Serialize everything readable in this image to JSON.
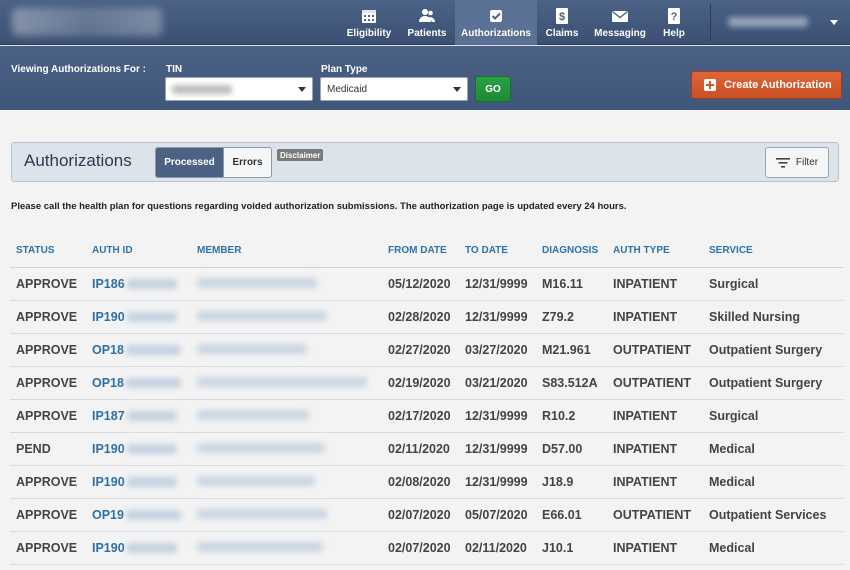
{
  "nav": {
    "items": [
      {
        "label": "Eligibility",
        "icon": "calendar-icon"
      },
      {
        "label": "Patients",
        "icon": "users-icon"
      },
      {
        "label": "Authorizations",
        "icon": "checkbox-icon"
      },
      {
        "label": "Claims",
        "icon": "dollar-doc-icon"
      },
      {
        "label": "Messaging",
        "icon": "envelope-icon"
      },
      {
        "label": "Help",
        "icon": "question-icon"
      }
    ],
    "active": "Authorizations"
  },
  "filters": {
    "viewing_label": "Viewing Authorizations For :",
    "tin_label": "TIN",
    "plan_type_label": "Plan Type",
    "plan_type_value": "Medicaid",
    "go_label": "GO",
    "create_label": "Create Authorization"
  },
  "panel": {
    "title": "Authorizations",
    "tabs": [
      "Processed",
      "Errors"
    ],
    "active_tab": "Processed",
    "disclaimer": "Disclaimer",
    "filter_label": "Filter"
  },
  "notice": "Please call the health plan for questions regarding voided authorization submissions. The authorization page is updated every 24 hours.",
  "table": {
    "columns": [
      "STATUS",
      "AUTH ID",
      "MEMBER",
      "FROM DATE",
      "TO DATE",
      "DIAGNOSIS",
      "AUTH TYPE",
      "SERVICE"
    ],
    "rows": [
      {
        "status": "APPROVE",
        "auth_id": "IP186",
        "from": "05/12/2020",
        "to": "12/31/9999",
        "diagnosis": "M16.11",
        "auth_type": "INPATIENT",
        "service": "Surgical"
      },
      {
        "status": "APPROVE",
        "auth_id": "IP190",
        "from": "02/28/2020",
        "to": "12/31/9999",
        "diagnosis": "Z79.2",
        "auth_type": "INPATIENT",
        "service": "Skilled Nursing"
      },
      {
        "status": "APPROVE",
        "auth_id": "OP18",
        "from": "02/27/2020",
        "to": "03/27/2020",
        "diagnosis": "M21.961",
        "auth_type": "OUTPATIENT",
        "service": "Outpatient Surgery"
      },
      {
        "status": "APPROVE",
        "auth_id": "OP18",
        "from": "02/19/2020",
        "to": "03/21/2020",
        "diagnosis": "S83.512A",
        "auth_type": "OUTPATIENT",
        "service": "Outpatient Surgery"
      },
      {
        "status": "APPROVE",
        "auth_id": "IP187",
        "from": "02/17/2020",
        "to": "12/31/9999",
        "diagnosis": "R10.2",
        "auth_type": "INPATIENT",
        "service": "Surgical"
      },
      {
        "status": "PEND",
        "auth_id": "IP190",
        "from": "02/11/2020",
        "to": "12/31/9999",
        "diagnosis": "D57.00",
        "auth_type": "INPATIENT",
        "service": "Medical"
      },
      {
        "status": "APPROVE",
        "auth_id": "IP190",
        "from": "02/08/2020",
        "to": "12/31/9999",
        "diagnosis": "J18.9",
        "auth_type": "INPATIENT",
        "service": "Medical"
      },
      {
        "status": "APPROVE",
        "auth_id": "OP19",
        "from": "02/07/2020",
        "to": "05/07/2020",
        "diagnosis": "E66.01",
        "auth_type": "OUTPATIENT",
        "service": "Outpatient Services"
      },
      {
        "status": "APPROVE",
        "auth_id": "IP190",
        "from": "02/07/2020",
        "to": "02/11/2020",
        "diagnosis": "J10.1",
        "auth_type": "INPATIENT",
        "service": "Medical"
      }
    ]
  },
  "colors": {
    "nav_bg": "#4b6286",
    "accent_blue": "#2e73a8",
    "go_green": "#1d8a36",
    "create_orange": "#d0542a"
  }
}
